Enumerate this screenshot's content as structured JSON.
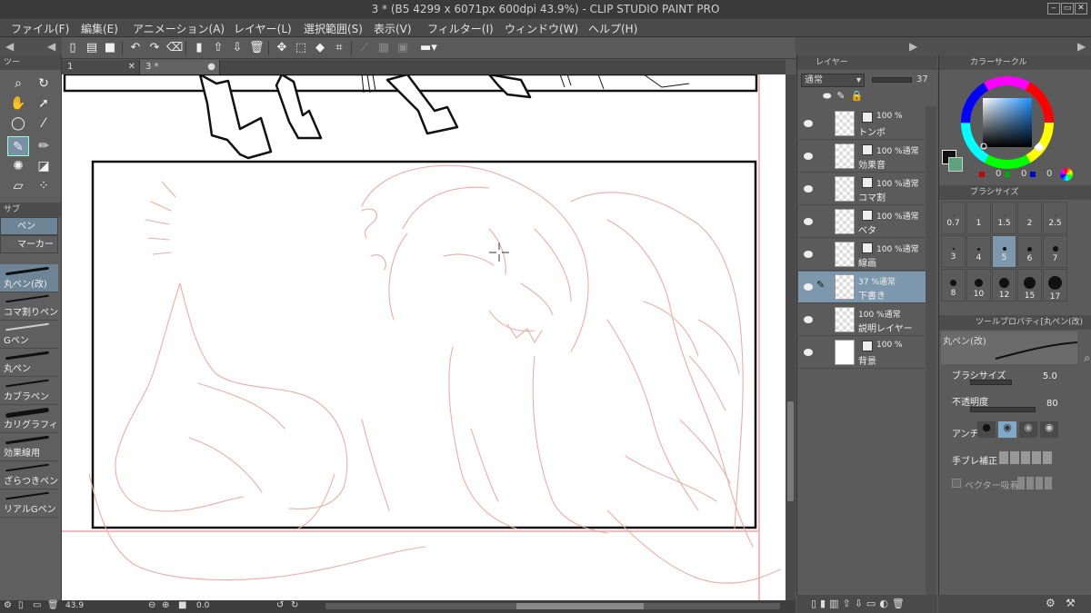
{
  "window": {
    "title": "3 * (B5 4299 x 6071px 600dpi 43.9%)  - CLIP STUDIO PAINT PRO",
    "min": "‒",
    "max": "▭",
    "close": "✕"
  },
  "menu": [
    "ファイル(F)",
    "編集(E)",
    "アニメーション(A)",
    "レイヤー(L)",
    "選択範囲(S)",
    "表示(V)",
    "フィルター(I)",
    "ウィンドウ(W)",
    "ヘルプ(H)"
  ],
  "tabs": [
    {
      "label": "1",
      "close": "✕"
    },
    {
      "label": "3 *",
      "close": "●"
    }
  ],
  "left_panel": {
    "tool_header": "ツー",
    "sub_header": "サブ",
    "subtools": [
      "ペン",
      "マーカー"
    ],
    "brushes": [
      "丸ペン(改)",
      "コマ割りペン",
      "Gペン",
      "丸ペン",
      "カブラペン",
      "カリグラフィ",
      "効果線用",
      "ざらつきペン",
      "リアルGペン"
    ]
  },
  "layers_panel": {
    "header": "レイヤー",
    "blend_mode": "通常",
    "opacity": "37",
    "layers": [
      {
        "line1": "100 %",
        "line2": "トンボ"
      },
      {
        "line1": "100 %通常",
        "line2": "効果音"
      },
      {
        "line1": "100 %通常",
        "line2": "コマ割"
      },
      {
        "line1": "100 %通常",
        "line2": "ベタ"
      },
      {
        "line1": "100 %通常",
        "line2": "線画"
      },
      {
        "line1": "37 %通常",
        "line2": "下書き"
      },
      {
        "line1": "100 %通常",
        "line2": "説明レイヤー"
      },
      {
        "line1": "100 %",
        "line2": "背景"
      }
    ]
  },
  "color_panel": {
    "header": "カラーサークル",
    "r": "0",
    "g": "0",
    "b": "0"
  },
  "brush_size_panel": {
    "header": "ブラシサイズ",
    "sizes": [
      "0.7",
      "1",
      "1.5",
      "2",
      "2.5",
      "3",
      "4",
      "5",
      "6",
      "7",
      "8",
      "10",
      "12",
      "15",
      "17"
    ]
  },
  "tool_property": {
    "header": "ツールプロパティ[丸ペン(改)",
    "tool_name": "丸ペン(改)",
    "brush_size_label": "ブラシサイズ",
    "brush_size_value": "5.0",
    "opacity_label": "不透明度",
    "opacity_value": "80",
    "antialias_label": "アンチ",
    "stabilization_label": "手ブレ補正",
    "vector_label": "ベクター吸着"
  },
  "status": {
    "zoom": "43.9",
    "angle": "0.0"
  },
  "colors": {
    "accent": "#7fa8c9",
    "sketch": "#e8a9a3",
    "lines": "#111111"
  }
}
